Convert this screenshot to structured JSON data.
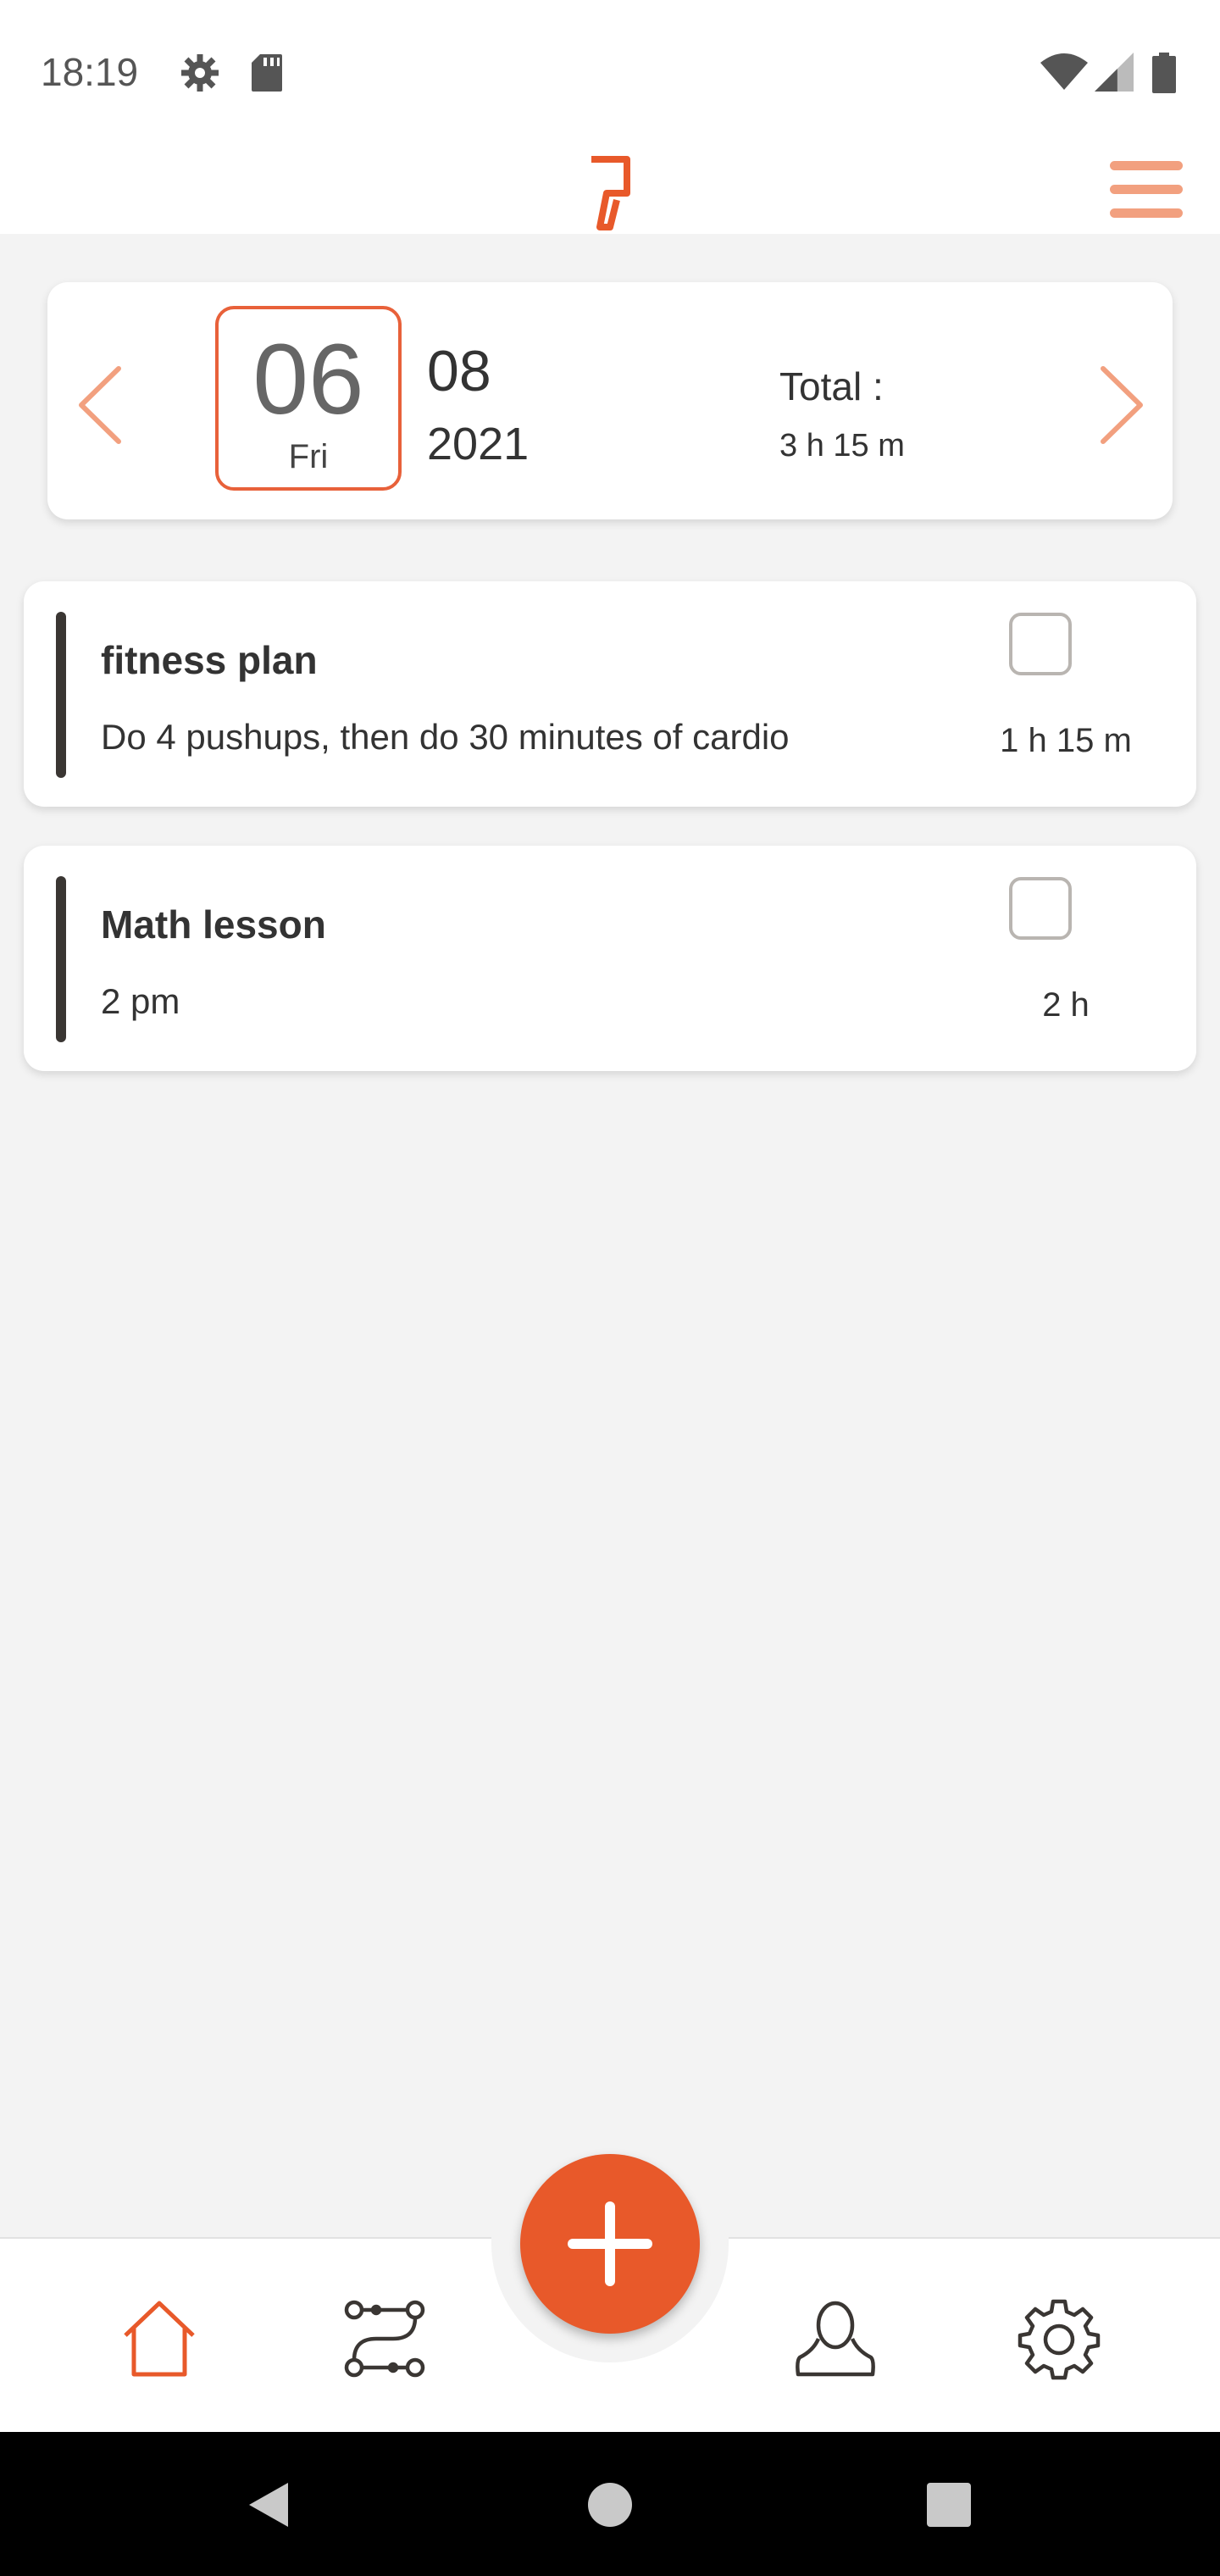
{
  "status_bar": {
    "time": "18:19"
  },
  "date_selector": {
    "day": "06",
    "weekday": "Fri",
    "month": "08",
    "year": "2021",
    "total_label": "Total :",
    "total_value": "3 h 15 m"
  },
  "tasks": [
    {
      "title": "fitness plan",
      "description": "Do 4 pushups, then do 30 minutes of cardio",
      "duration": "1 h 15 m",
      "completed": false
    },
    {
      "title": "Math lesson",
      "description": "2 pm",
      "duration": "2 h",
      "completed": false
    }
  ],
  "bottom_nav": {
    "items": [
      {
        "name": "home",
        "icon": "home-icon",
        "active": true
      },
      {
        "name": "routines",
        "icon": "route-icon",
        "active": false
      },
      {
        "name": "profile",
        "icon": "user-icon",
        "active": false
      },
      {
        "name": "settings",
        "icon": "gear-icon",
        "active": false
      }
    ],
    "add_icon": "plus-icon"
  },
  "colors": {
    "accent": "#e8592a",
    "accent_light": "#f2a07f",
    "background": "#f3f3f3",
    "card": "#ffffff"
  }
}
